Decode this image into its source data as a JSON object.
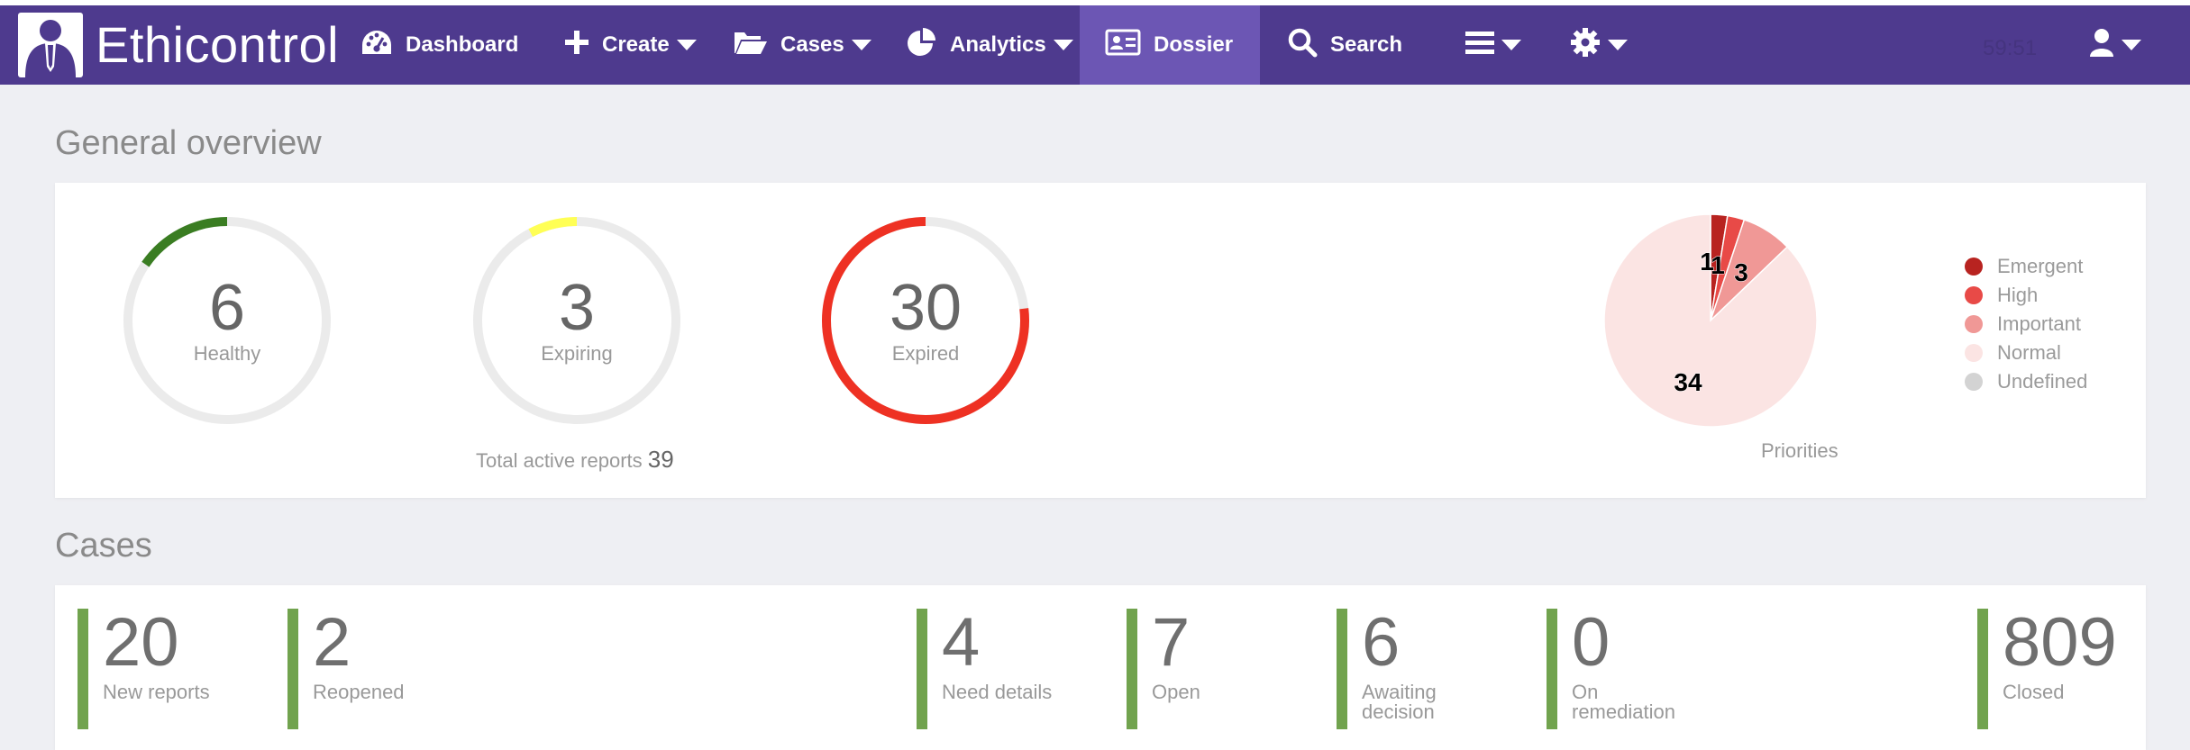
{
  "brand": {
    "name": "Ethicontrol"
  },
  "nav": {
    "dashboard": "Dashboard",
    "create": "Create",
    "cases": "Cases",
    "analytics": "Analytics",
    "dossier": "Dossier",
    "search": "Search",
    "timer": "59:51"
  },
  "colors": {
    "nav_bg": "#4e3a8e",
    "nav_active": "#6c56b4",
    "accent_green": "#71a34e"
  },
  "overview": {
    "title": "General overview",
    "gauges": [
      {
        "value": "6",
        "label": "Healthy",
        "fraction": 0.154,
        "color": "#3a7d22"
      },
      {
        "value": "3",
        "label": "Expiring",
        "fraction": 0.077,
        "color": "#ffff55"
      },
      {
        "value": "30",
        "label": "Expired",
        "fraction": 0.769,
        "color": "#ee3123"
      }
    ],
    "total_label": "Total active reports",
    "total_value": "39",
    "priorities_caption": "Priorities",
    "legend": [
      {
        "label": "Emergent",
        "color": "#b82320"
      },
      {
        "label": "High",
        "color": "#e84a47"
      },
      {
        "label": "Important",
        "color": "#f09896"
      },
      {
        "label": "Normal",
        "color": "#fbe4e3"
      },
      {
        "label": "Undefined",
        "color": "#d3d3d3"
      }
    ]
  },
  "chart_data": {
    "type": "pie",
    "title": "Priorities",
    "categories": [
      "Emergent",
      "High",
      "Important",
      "Normal",
      "Undefined"
    ],
    "values": [
      1,
      1,
      3,
      34,
      0
    ],
    "labels": [
      "1",
      "1",
      "3",
      "34",
      ""
    ]
  },
  "cases": {
    "title": "Cases",
    "stats": [
      {
        "value": "20",
        "label": "New reports"
      },
      {
        "value": "2",
        "label": "Reopened"
      },
      {
        "value": "4",
        "label": "Need details"
      },
      {
        "value": "7",
        "label": "Open"
      },
      {
        "value": "6",
        "label": "Awaiting decision"
      },
      {
        "value": "0",
        "label": "On remediation"
      },
      {
        "value": "809",
        "label": "Closed"
      }
    ]
  }
}
